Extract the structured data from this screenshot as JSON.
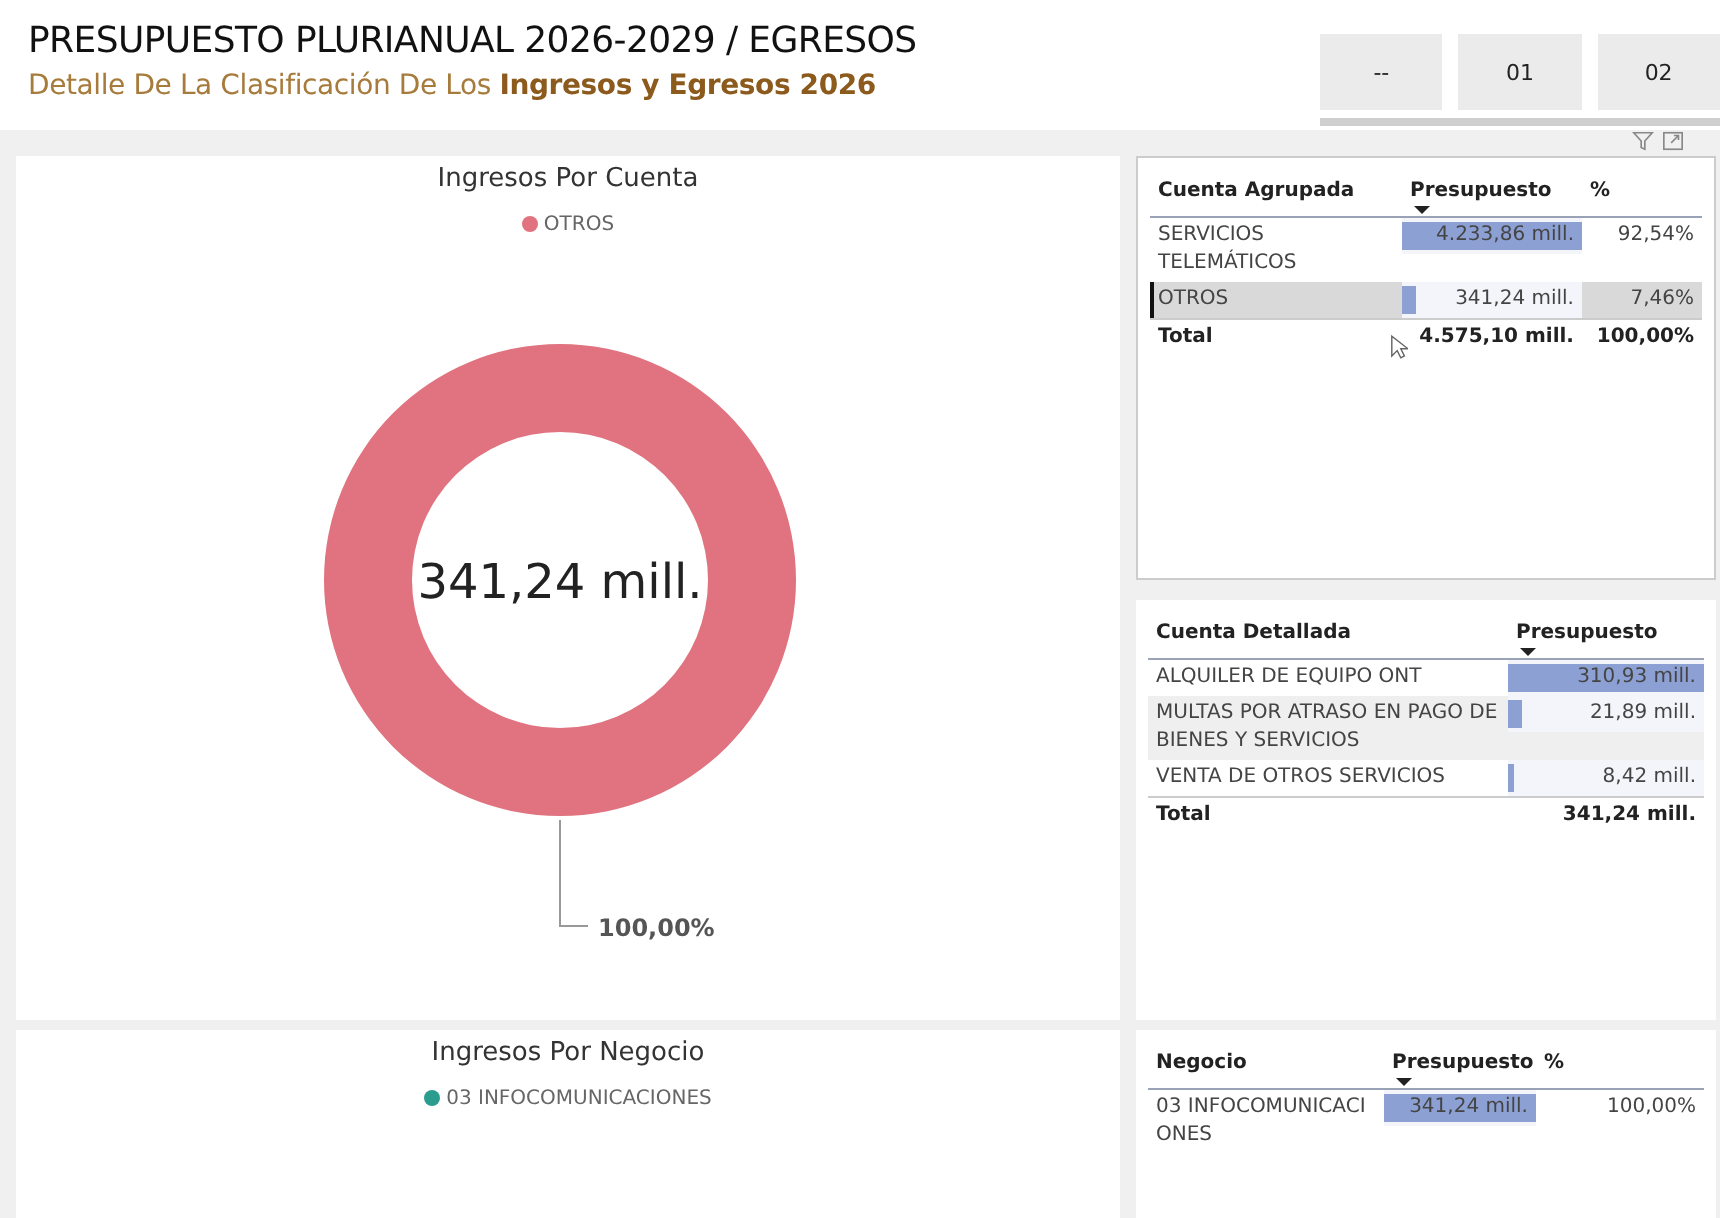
{
  "header": {
    "title": "PRESUPUESTO PLURIANUAL 2026-2029 / EGRESOS",
    "subtitle": "Detalle De La Clasificación De Los **Ingresos y Egresos 2026**",
    "slicer": [
      "--",
      "01",
      "02"
    ]
  },
  "chart_cuenta": {
    "title": "Ingresos Por Cuenta",
    "legend": [
      {
        "label": "OTROS",
        "color": "#e0737f"
      }
    ],
    "center_label": "341,24 mill.",
    "data_label": "100,00%"
  },
  "table_cuenta_agrupada": {
    "columns": [
      {
        "label": "Cuenta Agrupada",
        "sorted": false
      },
      {
        "label": "Presupuesto",
        "sorted": true
      },
      {
        "label": "%",
        "sorted": false
      }
    ],
    "rows": [
      {
        "cells": [
          "SERVICIOS TELEMÁTICOS",
          "4.233,86 mill.",
          "92,54%"
        ],
        "level": 1,
        "selected": false
      },
      {
        "cells": [
          "OTROS",
          "341,24 mill.",
          "7,46%"
        ],
        "level": 0.08,
        "selected": true
      }
    ],
    "total": [
      "Total",
      "4.575,10 mill.",
      "100,00%"
    ]
  },
  "table_cuenta_detallada": {
    "columns": [
      {
        "label": "Cuenta Detallada",
        "sorted": false
      },
      {
        "label": "Presupuesto",
        "sorted": true
      }
    ],
    "rows": [
      {
        "cells": [
          "ALQUILER DE EQUIPO ONT",
          "310,93 mill."
        ],
        "level": 1,
        "selected": false
      },
      {
        "cells": [
          "MULTAS POR ATRASO EN PAGO DE BIENES Y SERVICIOS",
          "21,89 mill."
        ],
        "level": 0.07,
        "selected": false
      },
      {
        "cells": [
          "VENTA DE OTROS SERVICIOS",
          "8,42 mill."
        ],
        "level": 0.03,
        "selected": false
      }
    ],
    "total": [
      "Total",
      "341,24 mill."
    ]
  },
  "chart_negocio": {
    "title": "Ingresos Por Negocio",
    "legend": [
      {
        "label": "03 INFOCOMUNICACIONES",
        "color": "#2a9d8f"
      }
    ]
  },
  "table_negocio": {
    "columns": [
      {
        "label": "Negocio",
        "sorted": false
      },
      {
        "label": "Presupuesto",
        "sorted": true
      },
      {
        "label": "%",
        "sorted": false
      }
    ],
    "rows": [
      {
        "cells": [
          "03 INFOCOMUNICACIONES",
          "341,24 mill.",
          "100,00%"
        ],
        "level": 1,
        "selected": false
      }
    ]
  }
}
